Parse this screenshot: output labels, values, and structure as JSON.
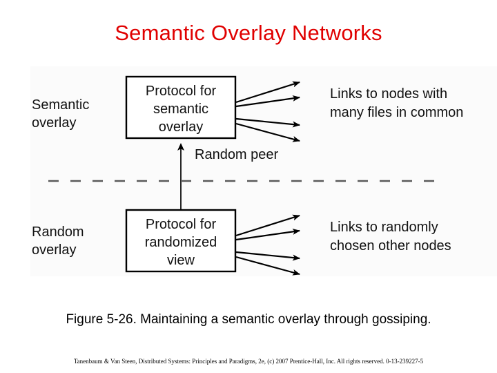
{
  "slide": {
    "title": "Semantic Overlay Networks",
    "title_color": "#e00000",
    "background_color": "#ffffff"
  },
  "figure": {
    "panel_background": "#fbfbfb",
    "left_labels": {
      "top_line1": "Semantic",
      "top_line2": "overlay",
      "bottom_line1": "Random",
      "bottom_line2": "overlay"
    },
    "boxes": {
      "top": {
        "line1": "Protocol for",
        "line2": "semantic",
        "line3": "overlay"
      },
      "bottom": {
        "line1": "Protocol for",
        "line2": "randomized",
        "line3": "view"
      }
    },
    "connector_label": "Random peer",
    "right_labels": {
      "top_line1": "Links to nodes with",
      "top_line2": "many files in common",
      "bottom_line1": "Links to randomly",
      "bottom_line2": "chosen other nodes"
    },
    "arrow_count_per_box": 4,
    "divider_style": "dashed"
  },
  "caption": "Figure 5-26. Maintaining a semantic overlay through gossiping.",
  "copyright": "Tanenbaum & Van Steen, Distributed Systems: Principles and Paradigms, 2e, (c) 2007 Prentice-Hall, Inc. All rights reserved. 0-13-239227-5"
}
